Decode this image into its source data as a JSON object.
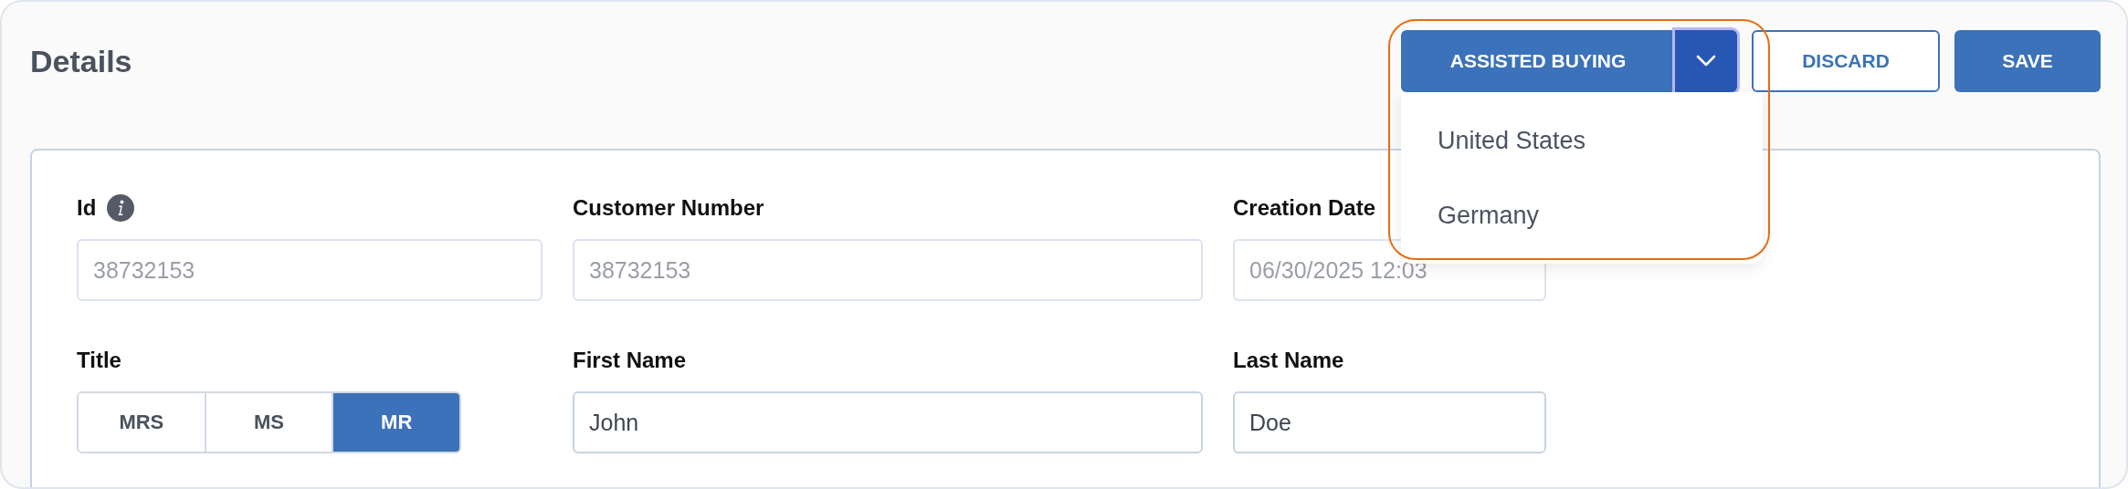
{
  "header": {
    "title": "Details"
  },
  "actions": {
    "split_button": {
      "label": "ASSISTED BUYING",
      "expanded": true,
      "menu": [
        {
          "label": "United States"
        },
        {
          "label": "Germany"
        }
      ]
    },
    "buttons": [
      {
        "label": "DISCARD",
        "kind": "outline"
      },
      {
        "label": "SAVE",
        "kind": "primary"
      }
    ]
  },
  "form": {
    "rows": [
      [
        {
          "kind": "text",
          "label": "Id",
          "info": true,
          "value": "38732153",
          "disabled": true
        },
        {
          "kind": "text",
          "label": "Customer Number",
          "info": false,
          "value": "38732153",
          "disabled": true
        },
        {
          "kind": "text",
          "label": "Creation Date",
          "info": false,
          "value": "06/30/2025 12:03",
          "disabled": true
        }
      ],
      [
        {
          "kind": "segmented",
          "label": "Title",
          "info": false,
          "options": [
            {
              "label": "MRS",
              "selected": false
            },
            {
              "label": "MS",
              "selected": false
            },
            {
              "label": "MR",
              "selected": true
            }
          ]
        },
        {
          "kind": "text",
          "label": "First Name",
          "info": false,
          "value": "John",
          "disabled": false
        },
        {
          "kind": "text",
          "label": "Last Name",
          "info": false,
          "value": "Doe",
          "disabled": false
        }
      ]
    ]
  }
}
